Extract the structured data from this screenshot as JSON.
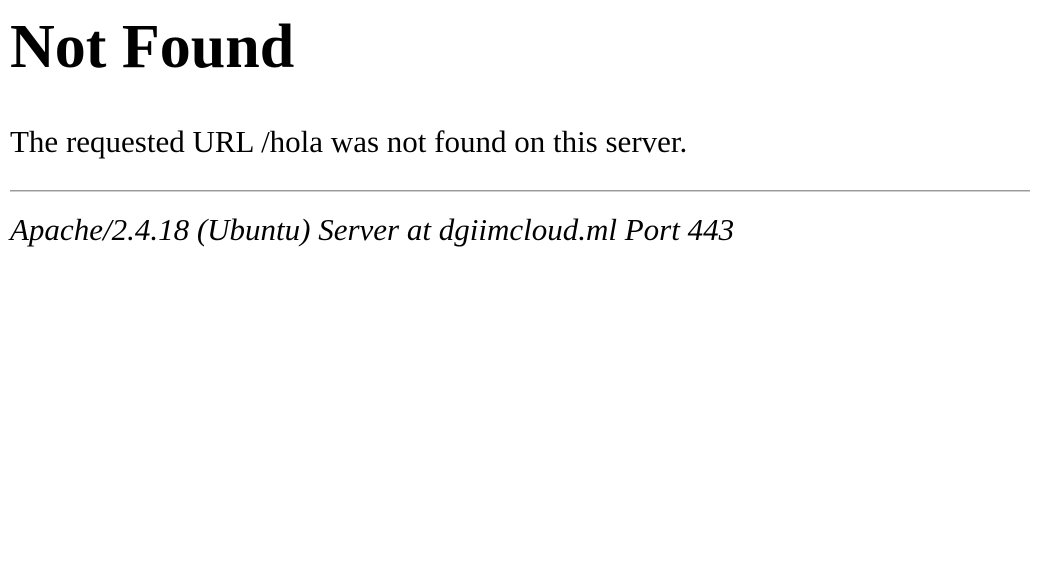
{
  "heading": "Not Found",
  "message": "The requested URL /hola was not found on this server.",
  "server_signature": "Apache/2.4.18 (Ubuntu) Server at dgiimcloud.ml Port 443"
}
